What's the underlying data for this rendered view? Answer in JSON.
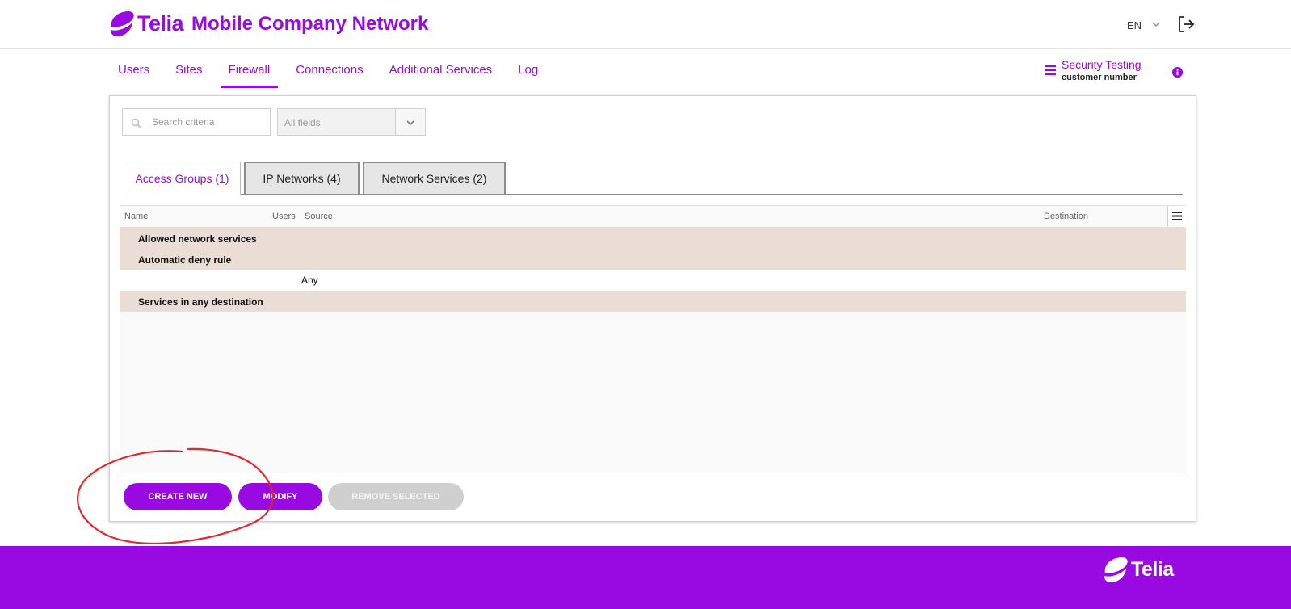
{
  "header": {
    "logo_text": "Telia",
    "app_title": "Mobile Company Network",
    "language": "EN"
  },
  "nav": {
    "items": [
      {
        "label": "Users"
      },
      {
        "label": "Sites"
      },
      {
        "label": "Firewall",
        "active": true
      },
      {
        "label": "Connections"
      },
      {
        "label": "Additional Services"
      },
      {
        "label": "Log"
      }
    ],
    "company_name": "Security Testing",
    "company_sub": "customer number"
  },
  "search": {
    "placeholder": "Search criteria",
    "field_select": "All fields"
  },
  "tabs": [
    {
      "label": "Access Groups (1)",
      "active": true
    },
    {
      "label": "IP Networks (4)"
    },
    {
      "label": "Network Services (2)"
    }
  ],
  "table": {
    "columns": [
      "Name",
      "Users",
      "Source",
      "Destination"
    ],
    "rows": [
      {
        "type": "group",
        "label": "Allowed network services"
      },
      {
        "type": "group",
        "label": "Automatic deny rule"
      },
      {
        "type": "data",
        "source": "Any"
      },
      {
        "type": "group",
        "label": "Services in any destination"
      }
    ]
  },
  "buttons": {
    "create_new": "CREATE NEW",
    "modify": "MODIFY",
    "remove_selected": "REMOVE SELECTED"
  },
  "footer": {
    "logo_text": "Telia"
  },
  "colors": {
    "brand": "#990ae3",
    "group_row": "#eaddd5",
    "annotation": "#e8252b"
  }
}
